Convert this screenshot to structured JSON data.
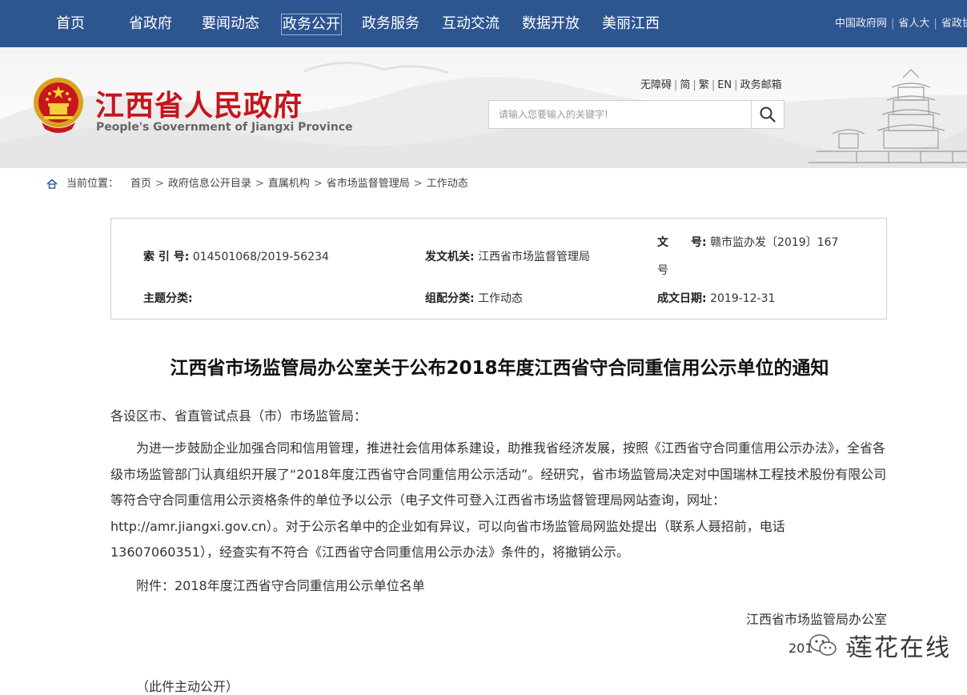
{
  "nav": {
    "items": [
      {
        "label": "首页"
      },
      {
        "label": "省政府"
      },
      {
        "label": "要闻动态"
      },
      {
        "label": "政务公开"
      },
      {
        "label": "政务服务"
      },
      {
        "label": "互动交流"
      },
      {
        "label": "数据开放"
      },
      {
        "label": "美丽江西"
      }
    ],
    "active": "政务公开",
    "top_links": [
      "中国政府网",
      "省人大",
      "省政协"
    ]
  },
  "header": {
    "site_name_cn": "江西省人民政府",
    "site_name_en": "People's Government of Jiangxi Province",
    "utility_links": [
      "无障碍",
      "简",
      "繁",
      "EN",
      "政务邮箱"
    ],
    "search_placeholder": "请输入您要输入的关键字!"
  },
  "breadcrumb": {
    "label": "当前位置：",
    "items": [
      "首页",
      "政府信息公开目录",
      "直属机构",
      "省市场监督管理局",
      "工作动态"
    ]
  },
  "info": {
    "index_label": "索 引 号:",
    "index_value": "014501068/2019-56234",
    "issuer_label": "发文机关:",
    "issuer_value": "江西省市场监督管理局",
    "doc_no_label_1": "文",
    "doc_no_label_2": "号:",
    "doc_no_value": "赣市监办发〔2019〕167",
    "doc_no_suffix": "号",
    "topic_label": "主题分类:",
    "topic_value": "",
    "category_label": "组配分类:",
    "category_value": "工作动态",
    "date_label": "成文日期:",
    "date_value": "2019-12-31"
  },
  "article": {
    "title": "江西省市场监管局办公室关于公布2018年度江西省守合同重信用公示单位的通知",
    "salutation": "各设区市、省直管试点县（市）市场监管局：",
    "body": "为进一步鼓励企业加强合同和信用管理，推进社会信用体系建设，助推我省经济发展，按照《江西省守合同重信用公示办法》，全省各级市场监管部门认真组织开展了“2018年度江西省守合同重信用公示活动”。经研究，省市场监管局决定对中国瑞林工程技术股份有限公司等符合守合同重信用公示资格条件的单位予以公示（电子文件可登入江西省市场监督管理局网站查询，网址：http://amr.jiangxi.gov.cn）。对于公示名单中的企业如有异议，可以向省市场监管局网监处提出（联系人聂招前，电话13607060351），经查实有不符合《江西省守合同重信用公示办法》条件的，将撤销公示。",
    "attachment": "附件：2018年度江西省守合同重信用公示单位名单",
    "signature": "江西省市场监管局办公室",
    "date_partial": "201",
    "date_partial_2": "1",
    "footer_note": "（此件主动公开）"
  },
  "watermark": {
    "text": "莲花在线"
  },
  "colors": {
    "nav_bg": "#2d5590",
    "site_name": "#c3161c"
  }
}
